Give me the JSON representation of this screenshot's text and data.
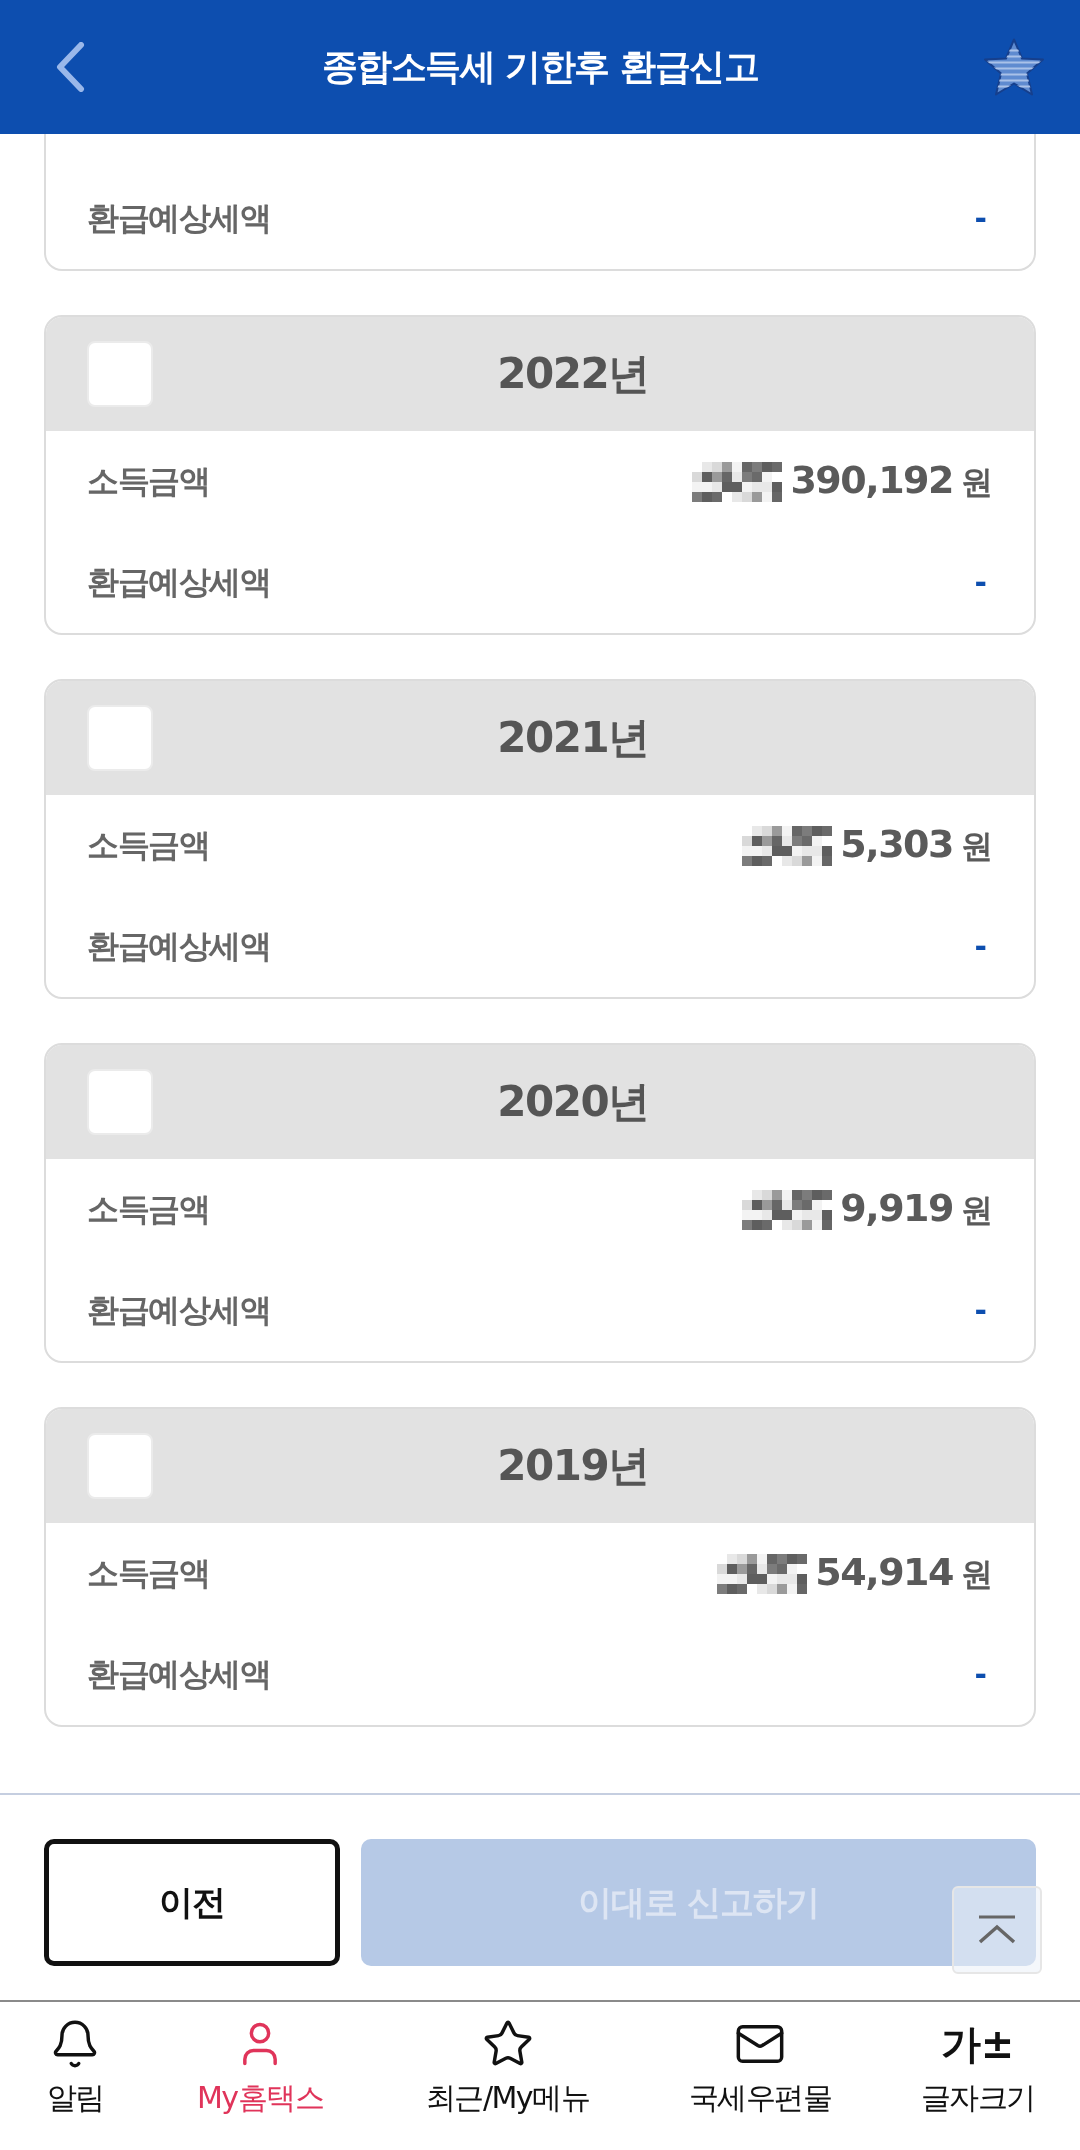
{
  "header": {
    "title": "종합소득세 기한후 환급신고"
  },
  "partial_card": {
    "rows": [
      {
        "kind": "refund",
        "label": "환급예상세액",
        "value": "-"
      }
    ]
  },
  "year_cards": [
    {
      "year": "2022년",
      "checked": false,
      "rows": [
        {
          "kind": "amount",
          "label": "소득금액",
          "redacted": true,
          "value": "390,192",
          "unit": "원"
        },
        {
          "kind": "refund",
          "label": "환급예상세액",
          "value": "-"
        }
      ]
    },
    {
      "year": "2021년",
      "checked": false,
      "rows": [
        {
          "kind": "amount",
          "label": "소득금액",
          "redacted": true,
          "value": "5,303",
          "unit": "원"
        },
        {
          "kind": "refund",
          "label": "환급예상세액",
          "value": "-"
        }
      ]
    },
    {
      "year": "2020년",
      "checked": false,
      "rows": [
        {
          "kind": "amount",
          "label": "소득금액",
          "redacted": true,
          "value": "9,919",
          "unit": "원"
        },
        {
          "kind": "refund",
          "label": "환급예상세액",
          "value": "-"
        }
      ]
    },
    {
      "year": "2019년",
      "checked": false,
      "rows": [
        {
          "kind": "amount",
          "label": "소득금액",
          "redacted": true,
          "value": "54,914",
          "unit": "원"
        },
        {
          "kind": "refund",
          "label": "환급예상세액",
          "value": "-"
        }
      ]
    }
  ],
  "buttons": [
    {
      "kind": "secondary",
      "label": "이전",
      "disabled": false
    },
    {
      "kind": "primary",
      "label": "이대로 신고하기",
      "disabled": true
    }
  ],
  "tab_bar": [
    {
      "kind": "icon",
      "label": "알림",
      "selected": false
    },
    {
      "kind": "icon",
      "label": "My홈택스",
      "selected": true
    },
    {
      "kind": "icon",
      "label": "최근/My메뉴",
      "selected": false
    },
    {
      "kind": "icon",
      "label": "국세우편물",
      "selected": false
    },
    {
      "kind": "glyph",
      "glyph": "가±",
      "label": "글자크기",
      "selected": false
    }
  ]
}
